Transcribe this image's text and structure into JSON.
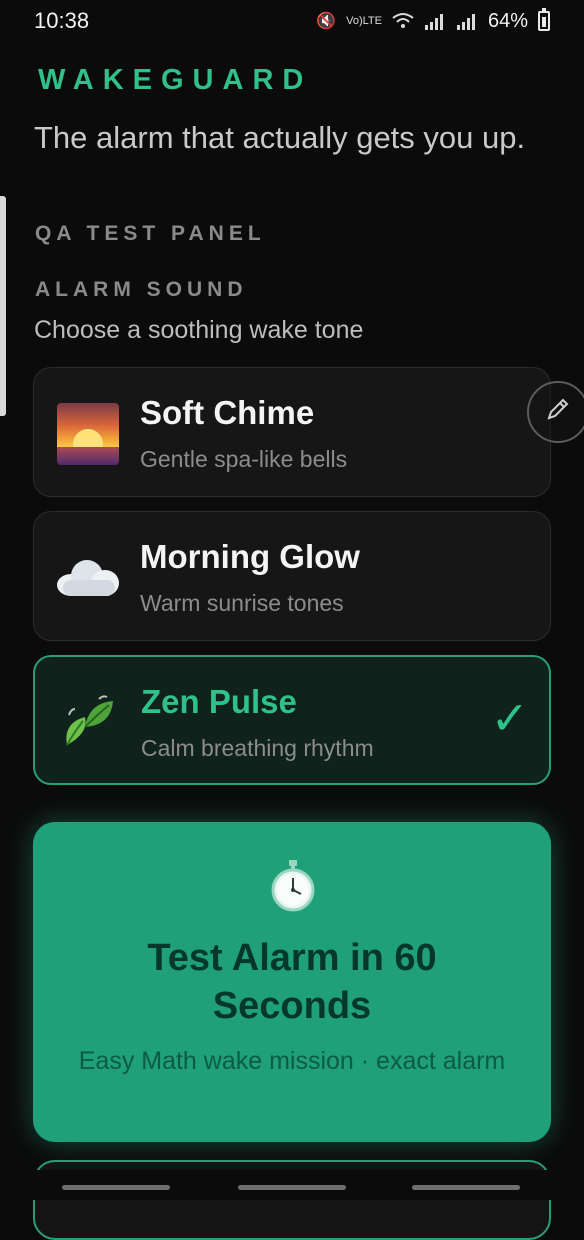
{
  "status_bar": {
    "time": "10:38",
    "network_label": "LTE",
    "battery": "64%"
  },
  "app": {
    "brand": "WAKEGUARD",
    "tagline": "The alarm that actually gets you up."
  },
  "qa_panel": {
    "label": "QA TEST PANEL"
  },
  "alarm_sound": {
    "label": "ALARM SOUND",
    "hint": "Choose a soothing wake tone",
    "tones": [
      {
        "title": "Soft Chime",
        "subtitle": "Gentle spa-like bells",
        "icon": "sunrise-icon",
        "selected": false
      },
      {
        "title": "Morning Glow",
        "subtitle": "Warm sunrise tones",
        "icon": "cloud-icon",
        "selected": false
      },
      {
        "title": "Zen Pulse",
        "subtitle": "Calm breathing rhythm",
        "icon": "leaf-icon",
        "selected": true
      }
    ]
  },
  "test_alarm": {
    "icon": "stopwatch-icon",
    "title": "Test Alarm in 60 Seconds",
    "subtitle": "Easy Math wake mission · exact alarm"
  },
  "colors": {
    "accent": "#2fc08b",
    "test_card": "#1fa078",
    "background": "#0b0b0c"
  }
}
